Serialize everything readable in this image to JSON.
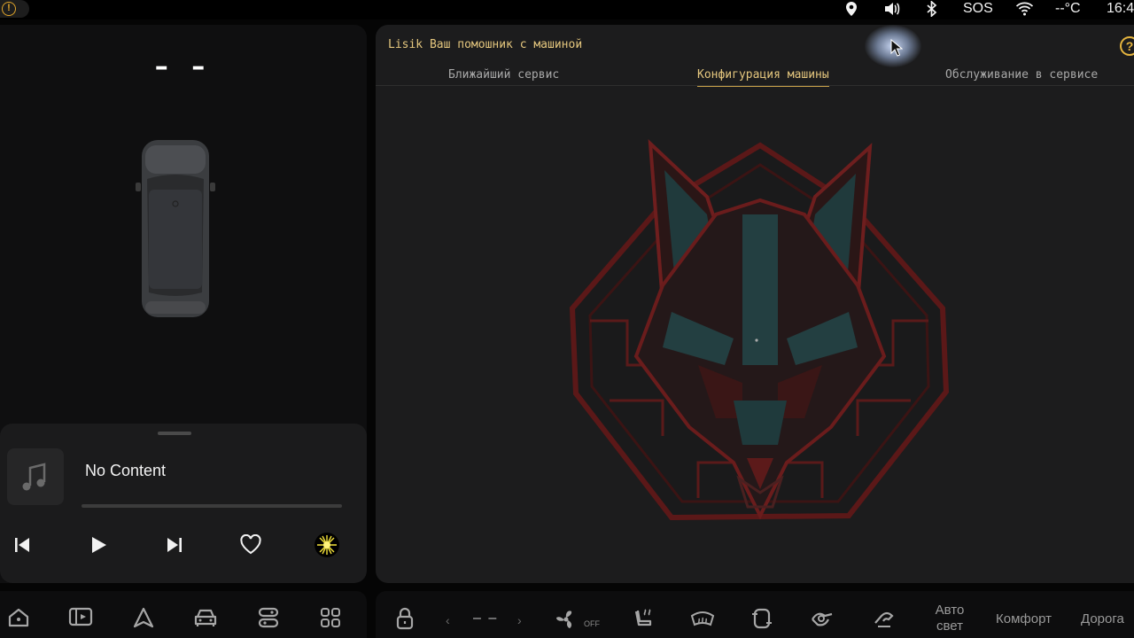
{
  "status_bar": {
    "warning_icon": "warning-circle-icon",
    "icons": [
      "location-pin-icon",
      "volume-icon",
      "bluetooth-icon",
      "wifi-icon"
    ],
    "sos_label": "SOS",
    "temperature": "--°C",
    "time": "16:4"
  },
  "left_panel": {
    "speed": "– –",
    "car_icon": "car-top-view-icon",
    "media": {
      "art_icon": "music-note-icon",
      "track_title": "No Content",
      "progress": 0,
      "controls": [
        "previous-icon",
        "play-icon",
        "next-icon",
        "heart-icon",
        "sun-effect-icon"
      ]
    }
  },
  "right_panel": {
    "title": "Lisik Ваш помошник с машиной",
    "help_label": "?",
    "tabs": [
      {
        "label": "Ближайший сервис",
        "active": false
      },
      {
        "label": "Конфигурация машины",
        "active": true
      },
      {
        "label": "Обслуживание в сервисе",
        "active": false
      }
    ],
    "logo": "wolf-emblem",
    "colors": {
      "accent": "#e5c77e",
      "emblem_red": "#7a1c1c",
      "emblem_teal": "#254a4c"
    }
  },
  "dock": {
    "apps": [
      "home-icon",
      "media-screen-icon",
      "navigation-icon",
      "car-icon",
      "controls-icon",
      "apps-grid-icon"
    ],
    "climate": {
      "temp_value": "– –",
      "fan_label": "OFF",
      "auto_light": "Авто\nсвет",
      "auto_light_line1": "Авто",
      "auto_light_line2": "свет",
      "comfort": "Комфорт",
      "road": "Дорога"
    }
  }
}
